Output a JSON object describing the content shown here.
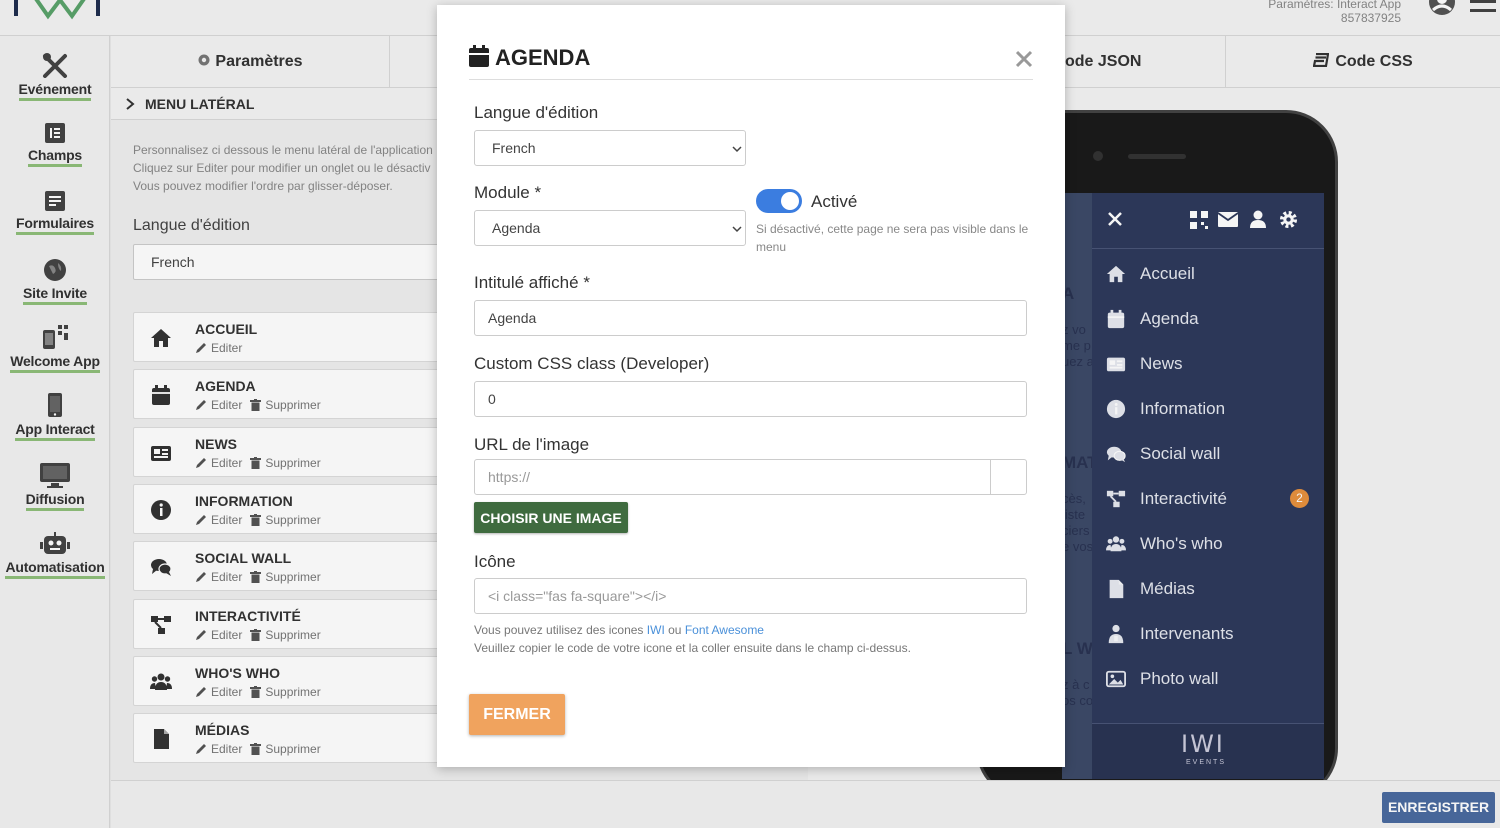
{
  "header": {
    "account_line1": "Paramètres: Interact App",
    "account_line2": "857837925"
  },
  "sidebar": {
    "items": [
      {
        "label": "Evénement",
        "icon": "tools-icon"
      },
      {
        "label": "Champs",
        "icon": "list-icon"
      },
      {
        "label": "Formulaires",
        "icon": "form-icon"
      },
      {
        "label": "Site Invite",
        "icon": "globe-icon"
      },
      {
        "label": "Welcome App",
        "icon": "qr-phone-icon"
      },
      {
        "label": "App Interact",
        "icon": "mobile-icon"
      },
      {
        "label": "Diffusion",
        "icon": "monitor-icon"
      },
      {
        "label": "Automatisation",
        "icon": "robot-icon"
      }
    ]
  },
  "tabs": {
    "params": "Paramètres",
    "json": "ode JSON",
    "css": "Code CSS"
  },
  "panel": {
    "section_title": "MENU LATÉRAL",
    "help_line1": "Personnalisez ci dessous le menu latéral de l'application",
    "help_line2": "Cliquez sur Editer pour modifier un onglet ou le désactiv",
    "help_line3": "Vous pouvez modifier l'ordre par glisser-déposer.",
    "lang_label": "Langue d'édition",
    "lang_value": "French",
    "edit_label": "Editer",
    "delete_label": "Supprimer",
    "items": [
      {
        "title": "ACCUEIL",
        "icon": "home-icon"
      },
      {
        "title": "AGENDA",
        "icon": "calendar-icon"
      },
      {
        "title": "NEWS",
        "icon": "newspaper-icon"
      },
      {
        "title": "INFORMATION",
        "icon": "info-icon"
      },
      {
        "title": "SOCIAL WALL",
        "icon": "comments-icon"
      },
      {
        "title": "INTERACTIVITÉ",
        "icon": "network-icon"
      },
      {
        "title": "WHO'S WHO",
        "icon": "users-icon"
      },
      {
        "title": "MÉDIAS",
        "icon": "file-icon"
      }
    ]
  },
  "phone": {
    "bg_fragments": [
      "A",
      "z vo",
      "me p",
      "uez a",
      "MATION",
      "cès,",
      "liste",
      "ciers",
      "e vos",
      "L WALL",
      "z à c",
      "os co"
    ],
    "menu": [
      {
        "label": "Accueil",
        "icon": "home-icon"
      },
      {
        "label": "Agenda",
        "icon": "calendar-icon"
      },
      {
        "label": "News",
        "icon": "newspaper-icon"
      },
      {
        "label": "Information",
        "icon": "info-icon"
      },
      {
        "label": "Social wall",
        "icon": "comments-icon"
      },
      {
        "label": "Interactivité",
        "icon": "network-icon"
      },
      {
        "label": "Who's who",
        "icon": "users-icon"
      },
      {
        "label": "Médias",
        "icon": "file-icon"
      },
      {
        "label": "Intervenants",
        "icon": "speaker-icon"
      },
      {
        "label": "Photo wall",
        "icon": "image-icon"
      }
    ],
    "badge": "2",
    "footer_logo": "IWI",
    "footer_sub": "EVENTS"
  },
  "modal": {
    "title": "AGENDA",
    "lang_label": "Langue d'édition",
    "lang_value": "French",
    "module_label": "Module *",
    "module_value": "Agenda",
    "active_label": "Activé",
    "active_on": true,
    "active_help": "Si désactivé, cette page ne sera pas visible dans le menu",
    "title_label": "Intitulé affiché *",
    "title_value": "Agenda",
    "css_label": "Custom CSS class (Developer)",
    "css_value": "0",
    "image_label": "URL de l'image",
    "image_placeholder": "https://",
    "choose_image": "CHOISIR UNE IMAGE",
    "icon_label": "Icône",
    "icon_placeholder": "<i class=\"fas fa-square\"></i>",
    "icon_help_prefix": "Vous pouvez utilisez des icones",
    "icon_help_link1": "IWI",
    "icon_help_or": "ou",
    "icon_help_link2": "Font Awesome",
    "icon_help_line2": "Veuillez copier le code de votre icone et la coller ensuite dans le champ ci-dessus.",
    "close_button": "FERMER"
  },
  "footer": {
    "save_button": "ENREGISTRER"
  },
  "colors": {
    "accent_blue": "#3b7de0",
    "save_blue": "#4a6ba0",
    "choose_green": "#3f6b3f",
    "close_orange": "#f0a35e",
    "drawer_bg": "#2e3a5c",
    "badge_orange": "#e8913e",
    "nav_underline": "#8fbf7a"
  }
}
